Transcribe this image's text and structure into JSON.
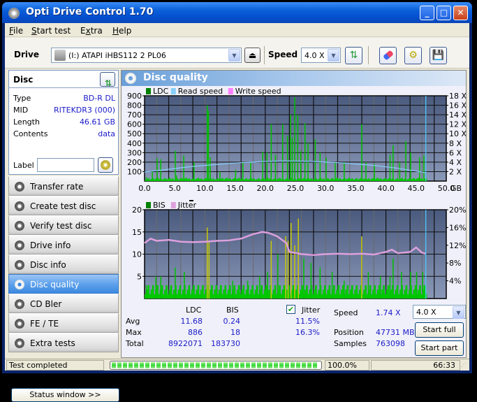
{
  "window": {
    "title": "Opti Drive Control 1.70"
  },
  "menu": [
    {
      "label": "File",
      "u": "F",
      "rest": "ile"
    },
    {
      "label": "Start test",
      "u": "S",
      "rest": "tart test"
    },
    {
      "label": "Extra",
      "pre": "E",
      "u": "x",
      "rest": "tra"
    },
    {
      "label": "Help",
      "u": "H",
      "rest": "elp"
    }
  ],
  "toolbar": {
    "drive_label": "Drive",
    "drive_value": "(I:)  ATAPI iHBS112  2 PL06",
    "speed_label": "Speed",
    "speed_value": "4.0 X"
  },
  "disc": {
    "header": "Disc",
    "type_label": "Type",
    "type": "BD-R DL",
    "mid_label": "MID",
    "mid": "RITEKDR3 (000)",
    "length_label": "Length",
    "length": "46.61 GB",
    "contents_label": "Contents",
    "contents": "data",
    "label_label": "Label",
    "label_value": ""
  },
  "nav": [
    {
      "label": "Transfer rate",
      "active": false
    },
    {
      "label": "Create test disc",
      "active": false
    },
    {
      "label": "Verify test disc",
      "active": false
    },
    {
      "label": "Drive info",
      "active": false
    },
    {
      "label": "Disc info",
      "active": false
    },
    {
      "label": "Disc quality",
      "active": true
    },
    {
      "label": "CD Bler",
      "active": false
    },
    {
      "label": "FE / TE",
      "active": false
    },
    {
      "label": "Extra tests",
      "active": false
    }
  ],
  "status_window_button": "Status window >>",
  "main": {
    "title": "Disc quality"
  },
  "chart_data": [
    {
      "type": "bar",
      "title": "LDC / Read speed",
      "legend": [
        "LDC",
        "Read speed",
        "Write speed"
      ],
      "legend_colors": [
        "#008000",
        "#87cefa",
        "#ff80ff"
      ],
      "xlabel": "GB",
      "x_ticks": [
        "0.0",
        "5.0",
        "10.0",
        "15.0",
        "20.0",
        "25.0",
        "30.0",
        "35.0",
        "40.0",
        "45.0",
        "50.0"
      ],
      "xlim": [
        0,
        50
      ],
      "y_left_ticks": [
        "100",
        "200",
        "300",
        "400",
        "500",
        "600",
        "700",
        "800",
        "900"
      ],
      "ylim_left": [
        0,
        900
      ],
      "y_right_ticks": [
        "2 X",
        "4 X",
        "6 X",
        "8 X",
        "10 X",
        "12 X",
        "14 X",
        "16 X",
        "18 X"
      ],
      "ylim_right": [
        0,
        18
      ],
      "ldc_peaks": [
        [
          0.2,
          40
        ],
        [
          1.2,
          100
        ],
        [
          2.0,
          240
        ],
        [
          2.6,
          230
        ],
        [
          5.0,
          320
        ],
        [
          5.2,
          60
        ],
        [
          6.4,
          270
        ],
        [
          8.1,
          200
        ],
        [
          10.3,
          800
        ],
        [
          10.5,
          740
        ],
        [
          10.8,
          250
        ],
        [
          12.4,
          100
        ],
        [
          15.0,
          120
        ],
        [
          16.2,
          200
        ],
        [
          17.5,
          200
        ],
        [
          19.5,
          310
        ],
        [
          20.2,
          300
        ],
        [
          20.9,
          600
        ],
        [
          21.6,
          280
        ],
        [
          22.8,
          600
        ],
        [
          23.6,
          480
        ],
        [
          24.1,
          700
        ],
        [
          24.4,
          460
        ],
        [
          24.8,
          886
        ],
        [
          25.3,
          700
        ],
        [
          25.8,
          320
        ],
        [
          26.5,
          610
        ],
        [
          27.0,
          400
        ],
        [
          28.2,
          440
        ],
        [
          29.0,
          300
        ],
        [
          30.0,
          250
        ],
        [
          31.5,
          200
        ],
        [
          33.0,
          200
        ],
        [
          35.9,
          600
        ],
        [
          36.6,
          200
        ],
        [
          38.0,
          180
        ],
        [
          40.6,
          280
        ],
        [
          41.1,
          380
        ],
        [
          42.2,
          200
        ],
        [
          43.2,
          420
        ],
        [
          44.0,
          300
        ],
        [
          45.5,
          250
        ],
        [
          46.2,
          270
        ]
      ],
      "read_speed": [
        [
          0,
          1.9
        ],
        [
          2,
          2.2
        ],
        [
          4,
          2.5
        ],
        [
          6,
          2.8
        ],
        [
          8,
          3.1
        ],
        [
          10,
          3.3
        ],
        [
          12,
          3.5
        ],
        [
          14,
          3.7
        ],
        [
          16,
          3.9
        ],
        [
          18,
          4.0
        ],
        [
          20,
          4.15
        ],
        [
          22,
          4.2
        ],
        [
          24,
          4.25
        ],
        [
          26,
          4.2
        ],
        [
          28,
          4.15
        ],
        [
          30,
          4.0
        ],
        [
          32,
          3.9
        ],
        [
          34,
          3.7
        ],
        [
          36,
          3.5
        ],
        [
          38,
          3.3
        ],
        [
          40,
          3.0
        ],
        [
          42,
          2.7
        ],
        [
          44,
          2.3
        ],
        [
          46,
          1.9
        ],
        [
          46.6,
          1.74
        ]
      ],
      "end_marker_gb": 46.61
    },
    {
      "type": "bar",
      "title": "BIS / Jitter",
      "legend": [
        "BIS",
        "Jitter"
      ],
      "legend_colors": [
        "#008000",
        "#dda0dd"
      ],
      "xlabel": "GB",
      "x_ticks": [
        "0.0",
        "5.0",
        "10.0",
        "15.0",
        "20.0",
        "25.0",
        "30.0",
        "35.0",
        "40.0",
        "45.0",
        "50.0"
      ],
      "xlim": [
        0,
        50
      ],
      "y_left_ticks": [
        "5",
        "10",
        "15",
        "20"
      ],
      "ylim_left": [
        0,
        20
      ],
      "y_right_ticks": [
        "4%",
        "8%",
        "12%",
        "16%",
        "20%"
      ],
      "ylim_right": [
        0,
        20
      ],
      "bis_peaks": [
        [
          0.2,
          3
        ],
        [
          1.8,
          5
        ],
        [
          2.6,
          5
        ],
        [
          5.0,
          7
        ],
        [
          6.5,
          6
        ],
        [
          10.3,
          16
        ],
        [
          10.6,
          13
        ],
        [
          14.5,
          4
        ],
        [
          17.0,
          4
        ],
        [
          19.0,
          5
        ],
        [
          20.3,
          6
        ],
        [
          20.9,
          13
        ],
        [
          22.0,
          10
        ],
        [
          23.3,
          14
        ],
        [
          23.7,
          13
        ],
        [
          24.2,
          17
        ],
        [
          24.8,
          12
        ],
        [
          25.4,
          18
        ],
        [
          26.3,
          9
        ],
        [
          27.5,
          8
        ],
        [
          29.0,
          7
        ],
        [
          31.0,
          6
        ],
        [
          33.0,
          4
        ],
        [
          35.9,
          14
        ],
        [
          37.0,
          6
        ],
        [
          39.0,
          5
        ],
        [
          40.6,
          5
        ],
        [
          41.1,
          9
        ],
        [
          42.5,
          6
        ],
        [
          44.0,
          6
        ],
        [
          45.0,
          6
        ],
        [
          46.0,
          6
        ]
      ],
      "jitter_pct": [
        [
          0,
          12.5
        ],
        [
          1,
          13.5
        ],
        [
          2,
          13.0
        ],
        [
          4,
          13.2
        ],
        [
          6,
          12.8
        ],
        [
          8,
          12.7
        ],
        [
          10,
          12.8
        ],
        [
          12,
          13.0
        ],
        [
          14,
          13.1
        ],
        [
          16,
          13.5
        ],
        [
          18,
          14.5
        ],
        [
          19.5,
          15.0
        ],
        [
          20.5,
          14.8
        ],
        [
          22,
          14.0
        ],
        [
          23.5,
          12.5
        ],
        [
          24,
          10.5
        ],
        [
          26,
          10.0
        ],
        [
          28,
          9.8
        ],
        [
          30,
          10.0
        ],
        [
          32,
          10.1
        ],
        [
          34,
          10.0
        ],
        [
          36,
          10.1
        ],
        [
          38,
          9.9
        ],
        [
          40,
          10.5
        ],
        [
          41,
          11.0
        ],
        [
          42,
          10.2
        ],
        [
          44,
          10.5
        ],
        [
          45,
          11.5
        ],
        [
          46,
          10.3
        ],
        [
          46.6,
          10.1
        ]
      ],
      "end_marker_gb": 46.61
    }
  ],
  "stats": {
    "col_ldc": "LDC",
    "col_bis": "BIS",
    "col_jitter": "Jitter",
    "jitter_checked": true,
    "avg_label": "Avg",
    "avg_ldc": "11.68",
    "avg_bis": "0.24",
    "avg_jitter": "11.5%",
    "max_label": "Max",
    "max_ldc": "886",
    "max_bis": "18",
    "max_jitter": "16.3%",
    "total_label": "Total",
    "total_ldc": "8922071",
    "total_bis": "183730",
    "speed_label": "Speed",
    "speed_value": "1.74 X",
    "position_label": "Position",
    "position_value": "47731 MB",
    "samples_label": "Samples",
    "samples_value": "763098",
    "speed_select": "4.0 X",
    "start_full": "Start full",
    "start_part": "Start part"
  },
  "statusbar": {
    "text": "Test completed",
    "progress_pct": 100,
    "progress_text": "100.0%",
    "time": "66:33"
  }
}
